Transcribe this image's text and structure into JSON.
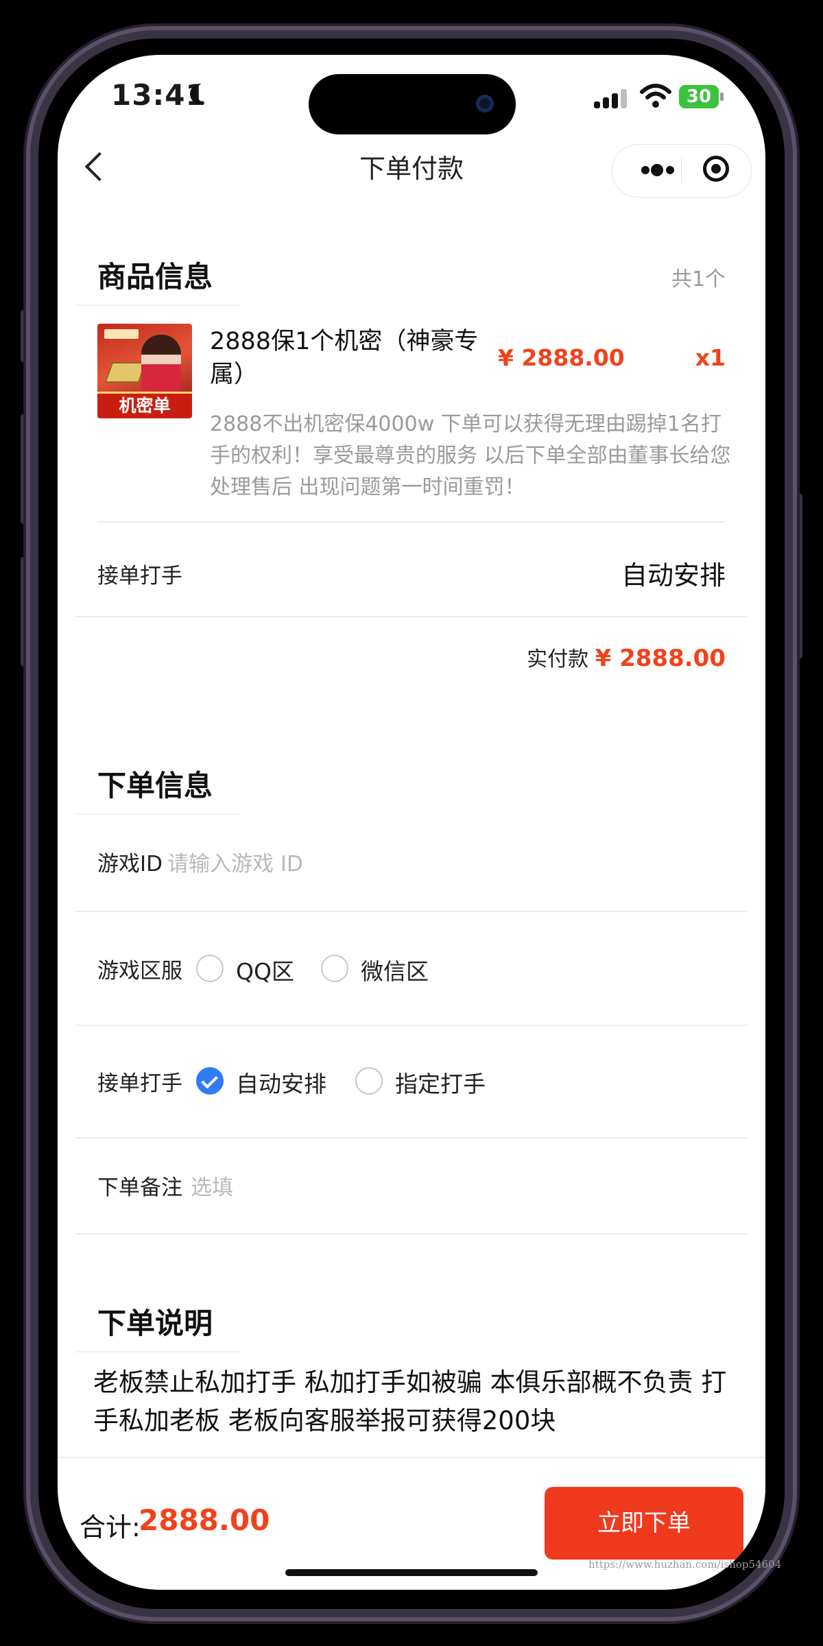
{
  "status_bar": {
    "time": "13:41",
    "battery": "30"
  },
  "nav": {
    "title": "下单付款"
  },
  "product_section": {
    "title": "商品信息",
    "count": "共1个",
    "thumb_label": "机密单",
    "name": "2888保1个机密（神豪专属）",
    "price": "¥ 2888.00",
    "qty": "x1",
    "desc": "2888不出机密保4000w 下单可以获得无理由踢掉1名打手的权利！享受最尊贵的服务 以后下单全部由董事长给您处理售后 出现问题第一时间重罚！",
    "assign_label": "接单打手",
    "assign_value": "自动安排",
    "paid_label": "实付款",
    "paid_value": "¥ 2888.00"
  },
  "order_section": {
    "title": "下单信息",
    "game_id_label": "游戏ID",
    "game_id_placeholder": "请输入游戏 ID",
    "game_id_value": "",
    "server_label": "游戏区服",
    "server_options": [
      "QQ区",
      "微信区"
    ],
    "server_selected": "",
    "player_label": "接单打手",
    "player_options": [
      "自动安排",
      "指定打手"
    ],
    "player_selected": "自动安排",
    "remark_label": "下单备注",
    "remark_placeholder": "选填",
    "remark_value": ""
  },
  "notes_section": {
    "title": "下单说明",
    "text": "老板禁止私加打手 私加打手如被骗 本俱乐部概不负责 打手私加老板 老板向客服举报可获得200块"
  },
  "bottom_bar": {
    "total_label": "合计:",
    "total_value": "2888.00",
    "submit_label": "立即下单"
  },
  "watermark": "https://www.huzhan.com/ishop54604",
  "colors": {
    "accent_red": "#f0421c",
    "radio_blue": "#2f7cf6",
    "battery_green": "#3cc23c"
  }
}
